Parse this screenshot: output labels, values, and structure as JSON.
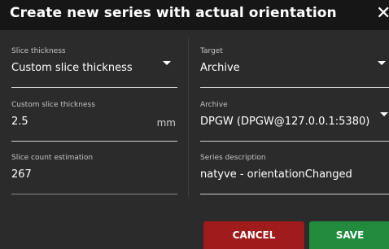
{
  "dialog": {
    "title": "Create new series with actual orientation",
    "close_glyph": "✕"
  },
  "fields": {
    "slice_thickness": {
      "label": "Slice thickness",
      "value": "Custom slice thickness"
    },
    "target": {
      "label": "Target",
      "value": "Archive"
    },
    "custom_slice_thickness": {
      "label": "Custom slice thickness",
      "value": "2.5",
      "unit": "mm"
    },
    "archive": {
      "label": "Archive",
      "value": "DPGW (DPGW@127.0.0.1:5380)"
    },
    "slice_count": {
      "label": "Slice count estimation",
      "value": "267"
    },
    "series_description": {
      "label": "Series description",
      "value": "natyve - orientationChanged"
    }
  },
  "buttons": {
    "cancel": "CANCEL",
    "save": "SAVE"
  },
  "colors": {
    "background": "#2b2b2b",
    "titlebar": "#161616",
    "cancel": "#a01b1b",
    "save": "#228b3e"
  }
}
